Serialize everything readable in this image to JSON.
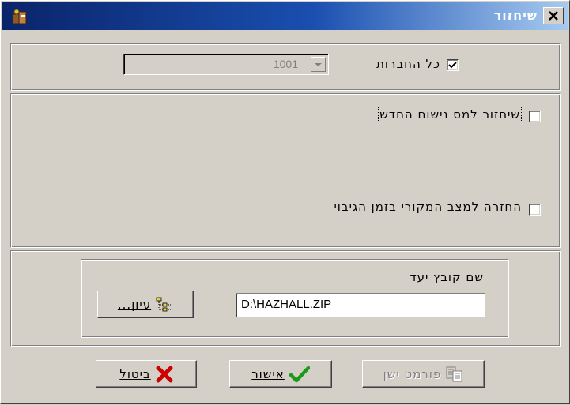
{
  "window": {
    "title": "שיחזור",
    "close_symbol": "✕"
  },
  "companies": {
    "checkbox_label": "כל החברות",
    "checked": true,
    "combo_value": "1001"
  },
  "options": {
    "restore_new_tax_label": "שיחזור למס נישום החדש",
    "restore_new_tax_checked": false,
    "restore_original_label": "החזרה למצב המקורי בזמן הגיבוי",
    "restore_original_checked": false
  },
  "target": {
    "label": "שם קובץ יעד",
    "value": "D:\\HAZHALL.ZIP",
    "browse_label": "עיון...",
    "browse_mnemonic": "ע"
  },
  "footer": {
    "cancel_label": "ביטול",
    "cancel_mnemonic": "ב",
    "ok_label": "אישור",
    "ok_mnemonic": "א",
    "old_format_label": "פורמט ישן"
  },
  "colors": {
    "title_dark": "#0a246a",
    "title_light": "#a6caf0",
    "face": "#d4d0c8",
    "cancel_red": "#cc0000",
    "ok_green": "#1a9a1a"
  },
  "icons": {
    "app": "app-icon",
    "close": "close-icon",
    "checkmark": "checkmark-icon",
    "dropdown": "chevron-down-icon",
    "browse": "tree-icon",
    "cancel": "x-icon",
    "ok": "check-icon",
    "old_format": "document-icon"
  }
}
